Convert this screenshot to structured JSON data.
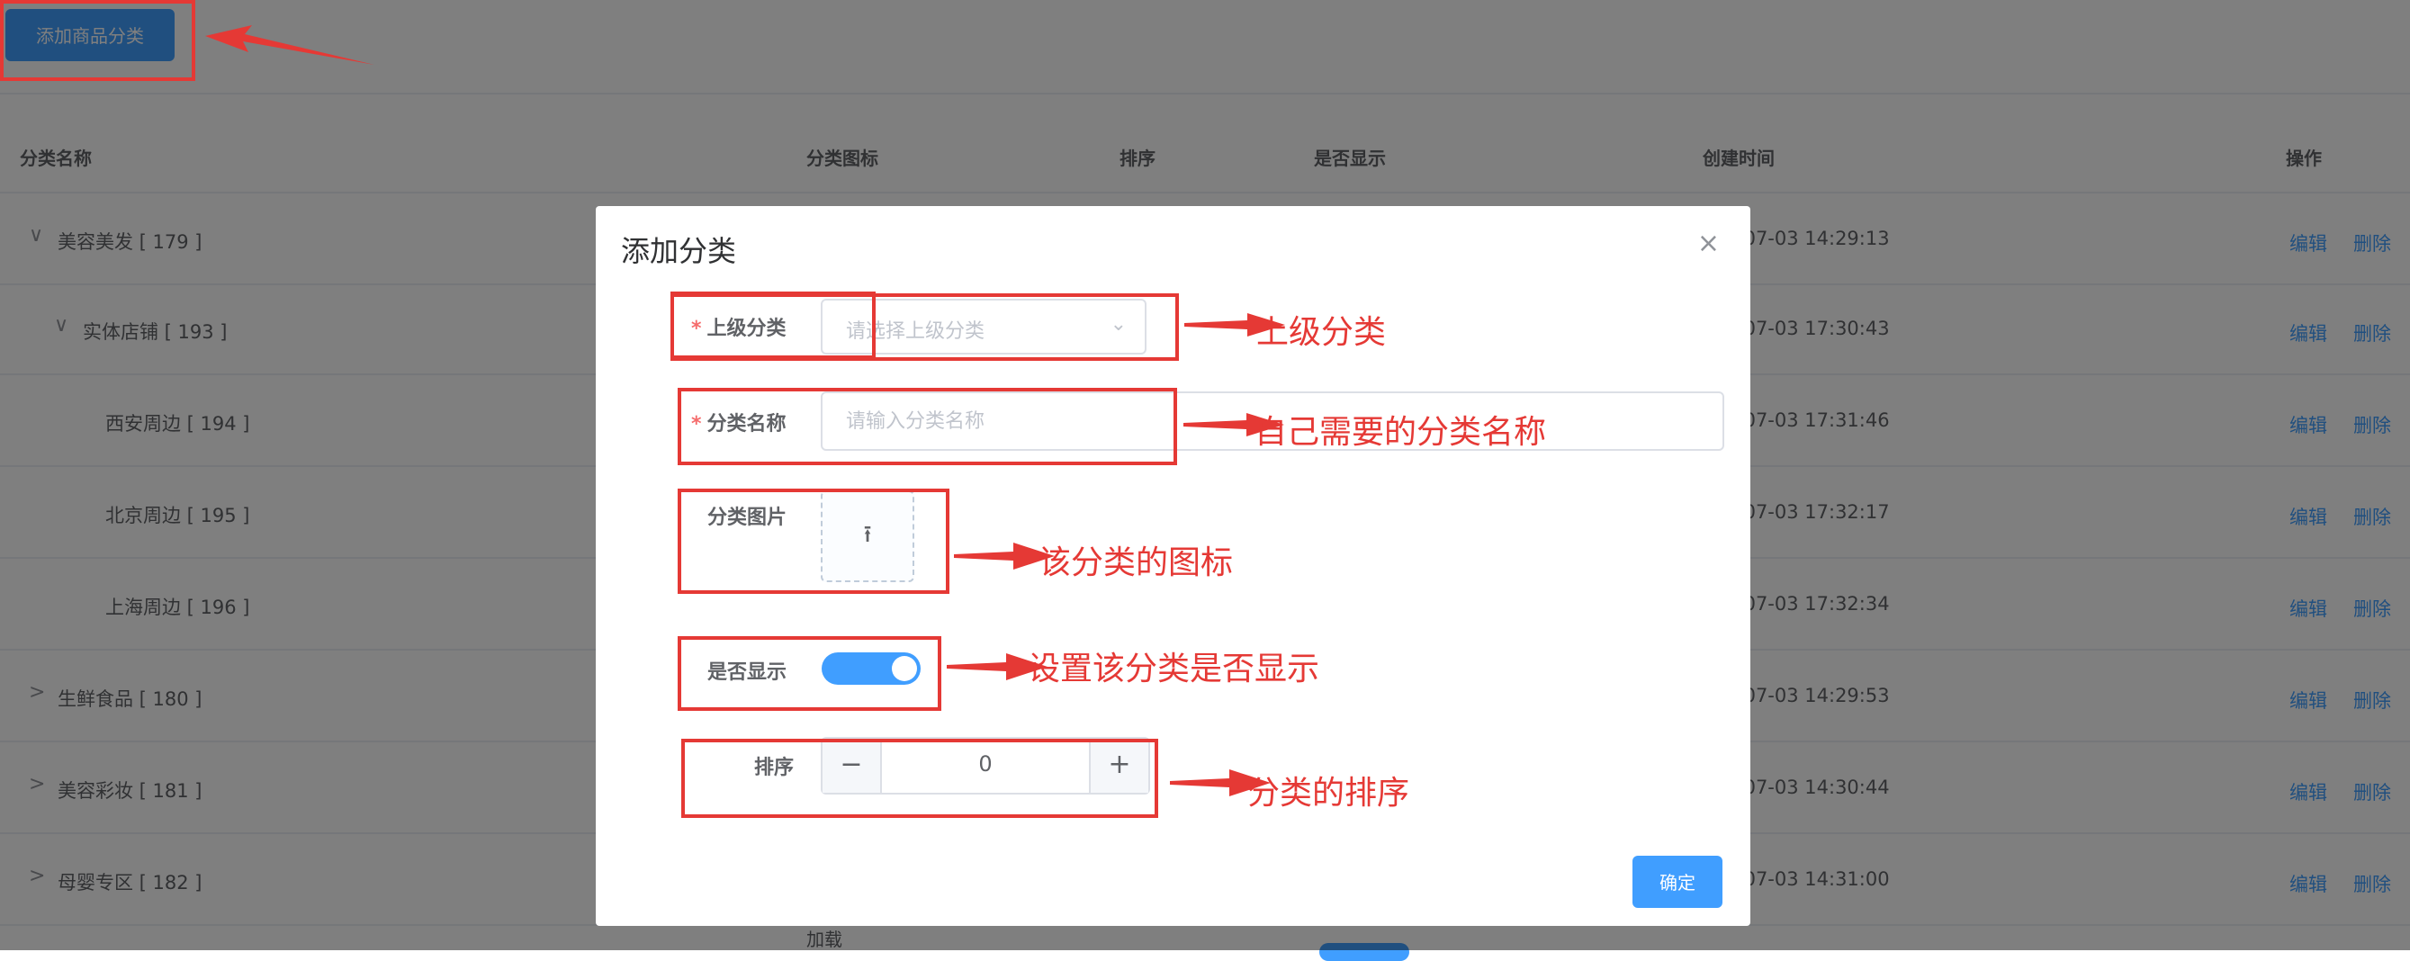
{
  "toolbar": {
    "add_category_label": "添加商品分类"
  },
  "table": {
    "headers": [
      "分类名称",
      "分类图标",
      "排序",
      "是否显示",
      "创建时间",
      "操作"
    ],
    "rows": [
      {
        "caret": "∨",
        "name": "美容美发 [ 179 ]",
        "time": "-07-03 14:29:13"
      },
      {
        "caret": "∨",
        "name": "实体店铺 [ 193 ]",
        "time": "-07-03 17:30:43"
      },
      {
        "caret": "",
        "name": "西安周边 [ 194 ]",
        "time": "-07-03 17:31:46"
      },
      {
        "caret": "",
        "name": "北京周边 [ 195 ]",
        "time": "-07-03 17:32:17"
      },
      {
        "caret": "",
        "name": "上海周边 [ 196 ]",
        "time": "-07-03 17:32:34"
      },
      {
        "caret": ">",
        "name": "生鲜食品 [ 180 ]",
        "time": "-07-03 14:29:53"
      },
      {
        "caret": ">",
        "name": "美容彩妆 [ 181 ]",
        "time": "-07-03 14:30:44"
      },
      {
        "caret": ">",
        "name": "母婴专区 [ 182 ]",
        "time": "-07-03 14:31:00"
      }
    ],
    "edit_label": "编辑",
    "delete_label": "删除",
    "loading_text": "加载"
  },
  "dialog": {
    "title": "添加分类",
    "close_icon": "×",
    "required_mark": "*",
    "parent_label": "上级分类",
    "parent_placeholder": "请选择上级分类",
    "name_label": "分类名称",
    "name_placeholder": "请输入分类名称",
    "image_label": "分类图片",
    "upload_icon": "⭱",
    "show_label": "是否显示",
    "show_value": true,
    "sort_label": "排序",
    "sort_value": "0",
    "minus": "−",
    "plus": "+",
    "confirm_label": "确定"
  },
  "annotations": {
    "parent": "上级分类",
    "name": "自己需要的分类名称",
    "image": "该分类的图标",
    "show": "设置该分类是否显示",
    "sort": "分类的排序"
  },
  "colors": {
    "primary": "#409eff",
    "annotation": "#e53935"
  }
}
